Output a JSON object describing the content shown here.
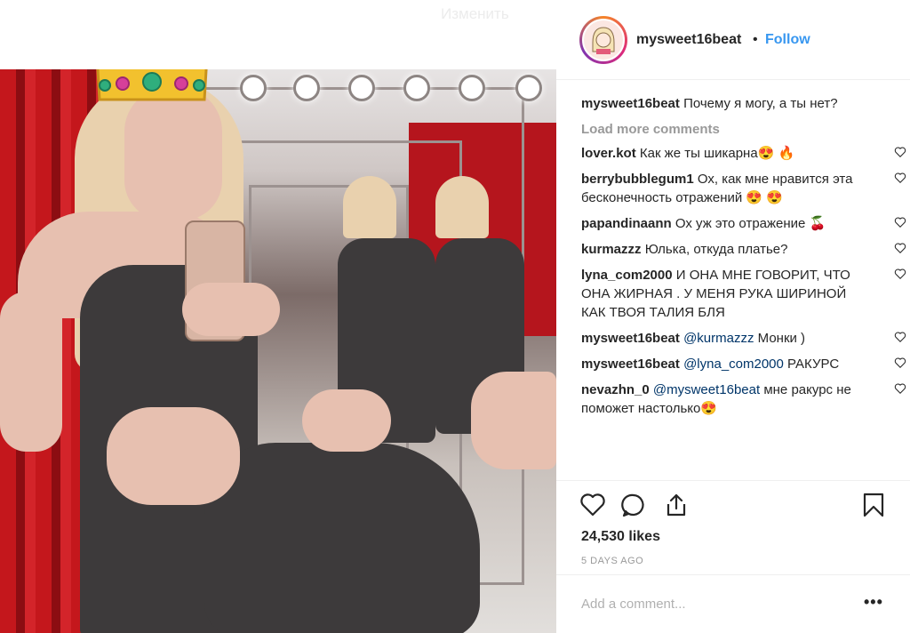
{
  "overlay": {
    "ghost_label": "Изменить"
  },
  "post": {
    "username": "mysweet16beat",
    "separator": "•",
    "follow_label": "Follow",
    "caption": {
      "username": "mysweet16beat",
      "text": "Почему я могу, а ты нет?"
    },
    "load_more_label": "Load more comments",
    "comments": [
      {
        "username": "lover.kot",
        "text": "Как же ты шикарна😍 🔥"
      },
      {
        "username": "berrybubblegum1",
        "text": "Ох, как мне нравится эта бесконечность отражений 😍 😍"
      },
      {
        "username": "papandinaann",
        "text": "Ох уж это отражение 🍒"
      },
      {
        "username": "kurmazzz",
        "text": "Юлька, откуда платье?"
      },
      {
        "username": "lyna_com2000",
        "text": "И ОНА МНЕ ГОВОРИТ, ЧТО ОНА ЖИРНАЯ . У МЕНЯ РУКА ШИРИНОЙ КАК ТВОЯ ТАЛИЯ БЛЯ"
      },
      {
        "username": "mysweet16beat",
        "mention": "@kurmazzz",
        "text": " Монки )"
      },
      {
        "username": "mysweet16beat",
        "mention": "@lyna_com2000",
        "text": " РАКУРС"
      },
      {
        "username": "nevazhn_0",
        "mention": "@mysweet16beat",
        "text": " мне ракурс не поможет настолько😍"
      }
    ],
    "likes": "24,530 likes",
    "timestamp": "5 DAYS AGO",
    "add_comment_placeholder": "Add a comment...",
    "more_options": "•••"
  },
  "icons": {
    "like": "heart-icon",
    "comment": "comment-icon",
    "share": "share-icon",
    "save": "bookmark-icon",
    "comment_like": "heart-outline-icon"
  },
  "colors": {
    "link_blue": "#3897f0",
    "mention_blue": "#003569",
    "muted_gray": "#999999",
    "curtain_red": "#c4171c"
  }
}
